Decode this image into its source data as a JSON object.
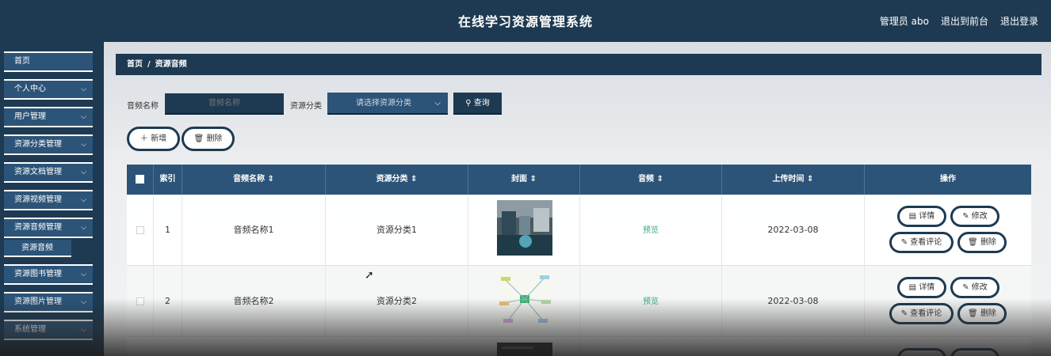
{
  "header": {
    "title": "在线学习资源管理系统",
    "admin_label": "管理员 abo",
    "exit_front_label": "退出到前台",
    "logout_label": "退出登录"
  },
  "sidebar": {
    "items": [
      {
        "label": "首页"
      },
      {
        "label": "个人中心"
      },
      {
        "label": "用户管理"
      },
      {
        "label": "资源分类管理"
      },
      {
        "label": "资源文档管理"
      },
      {
        "label": "资源视频管理"
      },
      {
        "label": "资源音频管理"
      },
      {
        "label": "资源图书管理"
      },
      {
        "label": "资源图片管理"
      },
      {
        "label": "系统管理"
      }
    ],
    "active_sub": "资源音频",
    "chevron": "⌵"
  },
  "breadcrumb": {
    "home": "首页",
    "separator": "/",
    "current": "资源音频"
  },
  "search": {
    "name_label": "音频名称",
    "name_placeholder": "音频名称",
    "category_label": "资源分类",
    "category_placeholder": "请选择资源分类",
    "query_label": "查询"
  },
  "actions": {
    "add_label": "新增",
    "delete_label": "删除"
  },
  "table": {
    "headers": [
      "索引",
      "音频名称",
      "资源分类",
      "封面",
      "音频",
      "上传时间",
      "操作"
    ],
    "sort_icon": "⇕",
    "rows": [
      {
        "index": "1",
        "name": "音频名称1",
        "category": "资源分类1",
        "audio": "预览",
        "time": "2022-03-08"
      },
      {
        "index": "2",
        "name": "音频名称2",
        "category": "资源分类2",
        "audio": "预览",
        "time": "2022-03-08"
      }
    ],
    "row_actions": {
      "detail": "详情",
      "edit": "修改",
      "comments": "查看评论",
      "delete": "删除"
    }
  },
  "colors": {
    "primary": "#1d3a52",
    "accent": "#2c5478",
    "preview_text": "#3aa77a"
  }
}
